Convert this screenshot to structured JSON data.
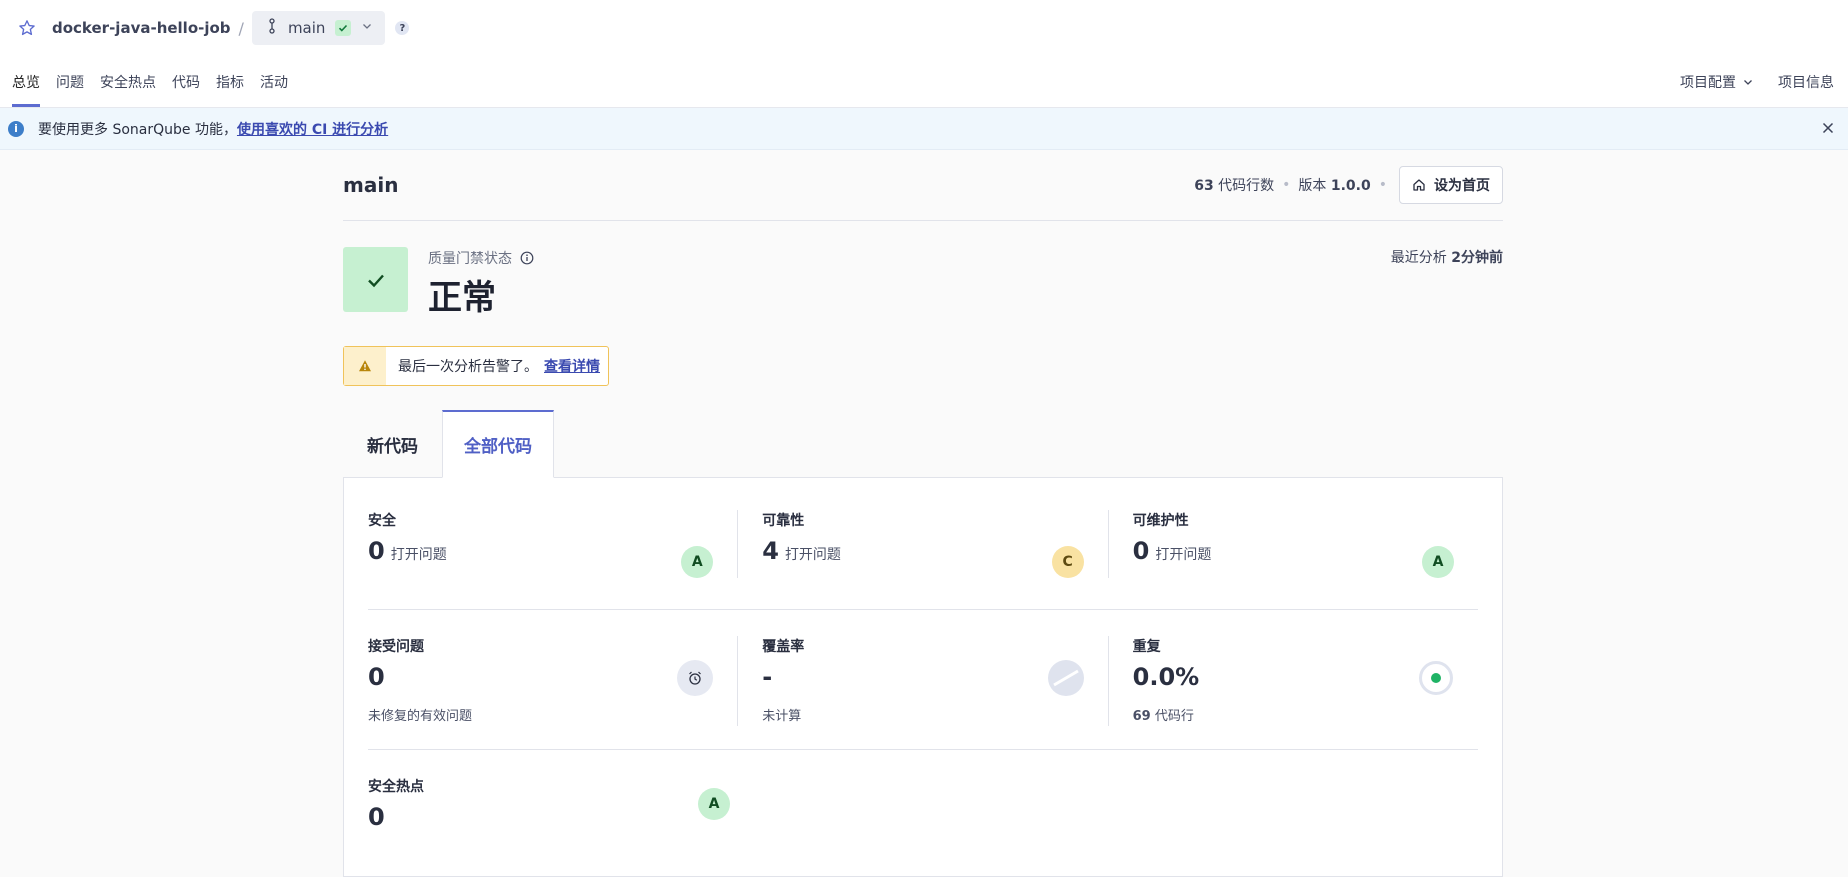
{
  "topbar": {
    "project": "docker-java-hello-job",
    "separator": "/",
    "branch": "main",
    "help": "?"
  },
  "nav": {
    "left": [
      "总览",
      "问题",
      "安全热点",
      "代码",
      "指标",
      "活动"
    ],
    "right": [
      "项目配置",
      "项目信息"
    ]
  },
  "banner": {
    "text": "要使用更多 SonarQube 功能，",
    "link": "使用喜欢的 CI 进行分析"
  },
  "header": {
    "title": "main",
    "lines": "63",
    "lines_label": "代码行数",
    "version_label": "版本",
    "version": "1.0.0",
    "home_button": "设为首页"
  },
  "quality_gate": {
    "label": "质量门禁状态",
    "status": "正常",
    "last_analysis_label": "最近分析",
    "last_analysis": "2分钟前"
  },
  "warning": {
    "text": "最后一次分析告警了。",
    "link": "查看详情"
  },
  "tabs": [
    "新代码",
    "全部代码"
  ],
  "metrics": {
    "security": {
      "title": "安全",
      "value": "0",
      "unit": "打开问题",
      "grade": "A"
    },
    "reliability": {
      "title": "可靠性",
      "value": "4",
      "unit": "打开问题",
      "grade": "C"
    },
    "maintainability": {
      "title": "可维护性",
      "value": "0",
      "unit": "打开问题",
      "grade": "A"
    },
    "accepted": {
      "title": "接受问题",
      "value": "0",
      "sub": "未修复的有效问题"
    },
    "coverage": {
      "title": "覆盖率",
      "value": "-",
      "sub": "未计算"
    },
    "duplication": {
      "title": "重复",
      "value": "0.0%",
      "sub_value": "69",
      "sub": "代码行"
    },
    "hotspots": {
      "title": "安全热点",
      "value": "0",
      "grade": "A"
    }
  },
  "colors": {
    "accent": "#5d6cd0",
    "grade_a": "#c6f0d1",
    "grade_c": "#f9e2a2",
    "pass": "#c6f0d1"
  }
}
